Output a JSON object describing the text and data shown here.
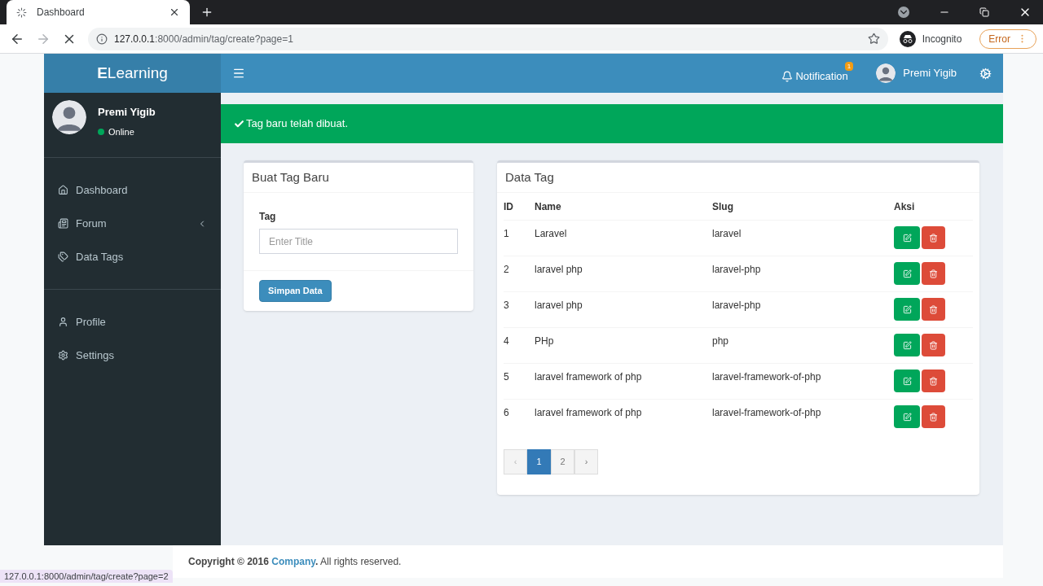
{
  "browser": {
    "tab": {
      "title": "Dashboard"
    },
    "url_host": "127.0.0.1",
    "url_rest": ":8000/admin/tag/create?page=1",
    "profile": "Incognito",
    "error_button": "Error",
    "status_url": "127.0.0.1:8000/admin/tag/create?page=2"
  },
  "header": {
    "logo_bold": "E",
    "logo_rest": "Learning",
    "notification": {
      "label": "Notification",
      "count": "1"
    },
    "user": "Premi Yigib"
  },
  "sidebar": {
    "user": {
      "name": "Premi Yigib",
      "status": "Online"
    },
    "groups": [
      [
        {
          "label": "Dashboard",
          "submenu": false
        },
        {
          "label": "Forum",
          "submenu": true
        },
        {
          "label": "Data Tags",
          "submenu": false
        }
      ],
      [
        {
          "label": "Profile",
          "submenu": false
        },
        {
          "label": "Settings",
          "submenu": false
        }
      ]
    ]
  },
  "alert": {
    "text": "Tag baru telah dibuat."
  },
  "form": {
    "title": "Buat Tag Baru",
    "label": "Tag",
    "placeholder": "Enter Title",
    "submit": "Simpan Data"
  },
  "table": {
    "title": "Data Tag",
    "columns": [
      "ID",
      "Name",
      "Slug",
      "Aksi"
    ],
    "rows": [
      {
        "id": "1",
        "name": "Laravel",
        "slug": "laravel"
      },
      {
        "id": "2",
        "name": "laravel php",
        "slug": "laravel-php"
      },
      {
        "id": "3",
        "name": "laravel php",
        "slug": "laravel-php"
      },
      {
        "id": "4",
        "name": "PHp",
        "slug": "php"
      },
      {
        "id": "5",
        "name": "laravel framework of php",
        "slug": "laravel-framework-of-php"
      },
      {
        "id": "6",
        "name": "laravel framework of php",
        "slug": "laravel-framework-of-php"
      }
    ],
    "pagination": [
      {
        "label": "‹",
        "selected": false,
        "disabled": true
      },
      {
        "label": "1",
        "selected": true,
        "disabled": false
      },
      {
        "label": "2",
        "selected": false,
        "disabled": false
      },
      {
        "label": "›",
        "selected": false,
        "disabled": false
      }
    ]
  },
  "footer": {
    "prefix": "Copyright © 2016",
    "link": "Company",
    "suffix": ". All rights reserved."
  }
}
